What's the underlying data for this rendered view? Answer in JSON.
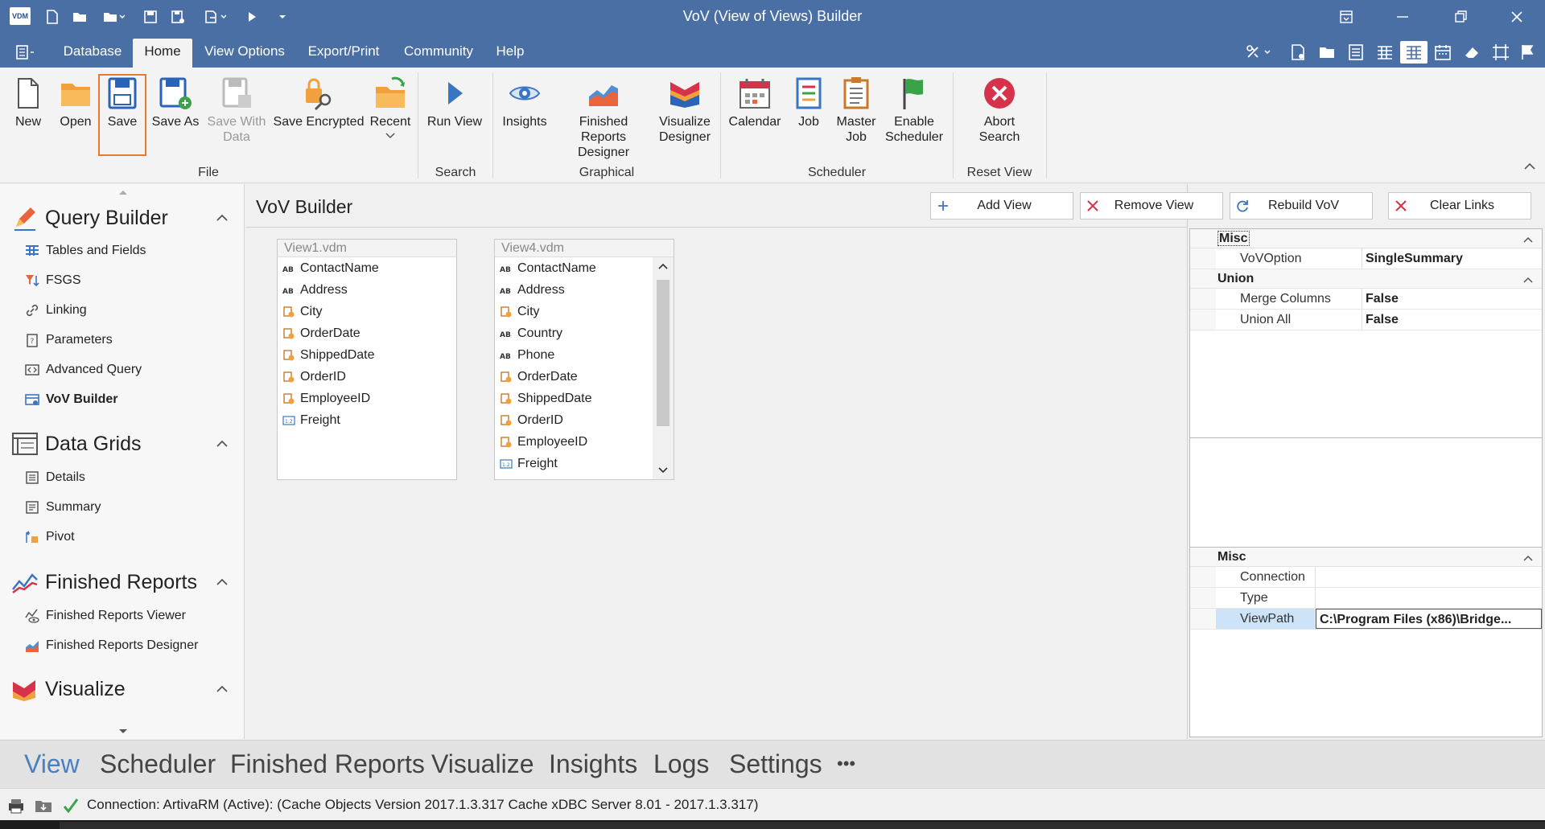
{
  "window": {
    "title": "VoV (View of Views) Builder",
    "app_icon_text": "VDM"
  },
  "menu": {
    "tabs": [
      "Database",
      "Home",
      "View Options",
      "Export/Print",
      "Community",
      "Help"
    ],
    "active_tab": "Home"
  },
  "ribbon": {
    "file": {
      "label": "File",
      "new": "New",
      "open": "Open",
      "save": "Save",
      "save_as": "Save As",
      "save_with_data_1": "Save With",
      "save_with_data_2": "Data",
      "save_encrypted": "Save Encrypted",
      "recent": "Recent"
    },
    "search": {
      "label": "Search",
      "run_view": "Run View"
    },
    "graphical": {
      "label": "Graphical",
      "insights": "Insights",
      "frd_1": "Finished Reports",
      "frd_2": "Designer",
      "vis_1": "Visualize",
      "vis_2": "Designer"
    },
    "scheduler": {
      "label": "Scheduler",
      "calendar": "Calendar",
      "job": "Job",
      "master_1": "Master",
      "master_2": "Job",
      "enable_1": "Enable",
      "enable_2": "Scheduler"
    },
    "reset": {
      "label": "Reset View",
      "abort_1": "Abort",
      "abort_2": "Search"
    }
  },
  "leftnav": {
    "query_builder": {
      "title": "Query Builder",
      "items": [
        "Tables and Fields",
        "FSGS",
        "Linking",
        "Parameters",
        "Advanced Query",
        "VoV Builder"
      ]
    },
    "data_grids": {
      "title": "Data Grids",
      "items": [
        "Details",
        "Summary",
        "Pivot"
      ]
    },
    "finished_reports": {
      "title": "Finished Reports",
      "items": [
        "Finished Reports Viewer",
        "Finished Reports Designer"
      ]
    },
    "visualize": {
      "title": "Visualize"
    }
  },
  "main": {
    "title": "VoV Builder",
    "toolbar": {
      "add_view": "Add View",
      "remove_view": "Remove View",
      "rebuild_vov": "Rebuild VoV",
      "clear_links": "Clear Links"
    },
    "views": [
      {
        "name": "View1.vdm",
        "fields": [
          {
            "name": "ContactName",
            "type": "text"
          },
          {
            "name": "Address",
            "type": "text"
          },
          {
            "name": "City",
            "type": "key"
          },
          {
            "name": "OrderDate",
            "type": "key"
          },
          {
            "name": "ShippedDate",
            "type": "key"
          },
          {
            "name": "OrderID",
            "type": "key"
          },
          {
            "name": "EmployeeID",
            "type": "key"
          },
          {
            "name": "Freight",
            "type": "number"
          }
        ]
      },
      {
        "name": "View4.vdm",
        "fields": [
          {
            "name": "ContactName",
            "type": "text"
          },
          {
            "name": "Address",
            "type": "text"
          },
          {
            "name": "City",
            "type": "key"
          },
          {
            "name": "Country",
            "type": "text"
          },
          {
            "name": "Phone",
            "type": "text"
          },
          {
            "name": "OrderDate",
            "type": "key"
          },
          {
            "name": "ShippedDate",
            "type": "key"
          },
          {
            "name": "OrderID",
            "type": "key"
          },
          {
            "name": "EmployeeID",
            "type": "key"
          },
          {
            "name": "Freight",
            "type": "number"
          }
        ]
      }
    ]
  },
  "properties": {
    "top": {
      "misc_label": "Misc",
      "vov_option_name": "VoVOption",
      "vov_option_value": "SingleSummary",
      "union_label": "Union",
      "merge_columns_name": "Merge Columns",
      "merge_columns_value": "False",
      "union_all_name": "Union All",
      "union_all_value": "False"
    },
    "bottom": {
      "misc_label": "Misc",
      "connection_name": "Connection",
      "connection_value": "",
      "type_name": "Type",
      "type_value": "",
      "viewpath_name": "ViewPath",
      "viewpath_value": "C:\\Program Files (x86)\\Bridge..."
    }
  },
  "bottomnav": {
    "items": [
      "View",
      "Scheduler",
      "Finished Reports",
      "Visualize",
      "Insights",
      "Logs",
      "Settings"
    ],
    "more": "•••",
    "active": "View"
  },
  "status": {
    "text": "Connection: ArtivaRM (Active): (Cache Objects Version 2017.1.3.317 Cache xDBC Server 8.01 - 2017.1.3.317)"
  },
  "colors": {
    "title_bar": "#4a6fa5",
    "accent": "#4a7fc2",
    "selected_outline": "#e87a2f"
  }
}
